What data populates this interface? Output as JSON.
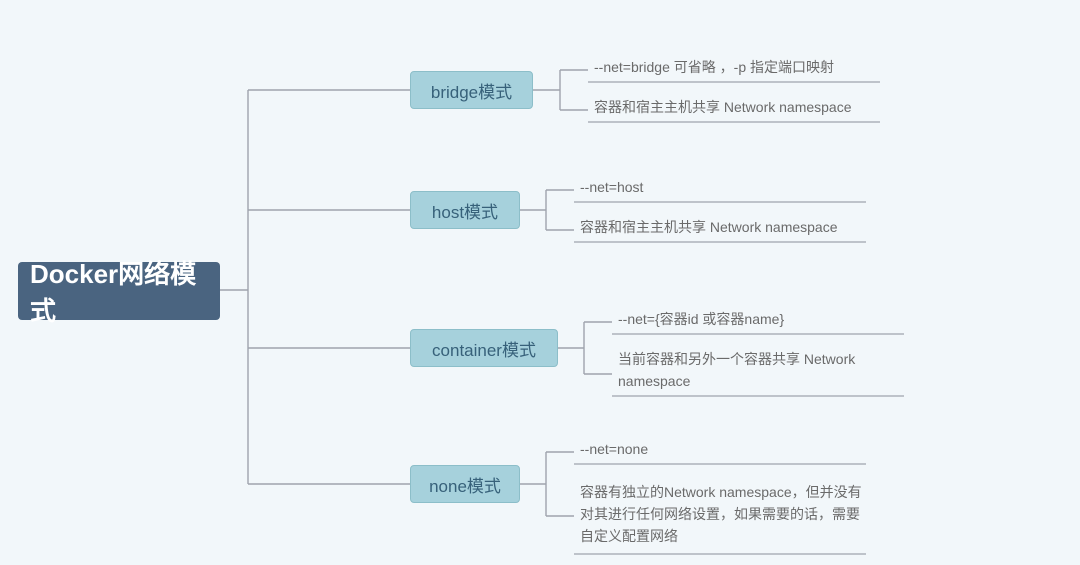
{
  "colors": {
    "background": "#f2f7fa",
    "root_bg": "#4a6480",
    "root_text": "#ffffff",
    "branch_bg": "#a6d1dc",
    "branch_border": "#8cbec9",
    "branch_text": "#37617a",
    "leaf_text": "#6a6a6a",
    "connector": "#9FA4AD"
  },
  "root": {
    "label": "Docker网络模式"
  },
  "branches": [
    {
      "key": "bridge",
      "label": "bridge模式",
      "leaves": [
        "--net=bridge   可省略 ，-p 指定端口映射",
        "容器和宿主主机共享 Network namespace"
      ]
    },
    {
      "key": "host",
      "label": "host模式",
      "leaves": [
        "--net=host",
        "容器和宿主主机共享 Network namespace"
      ]
    },
    {
      "key": "container",
      "label": "container模式",
      "leaves": [
        "--net={容器id 或容器name}",
        "当前容器和另外一个容器共享 Network namespace"
      ]
    },
    {
      "key": "none",
      "label": "none模式",
      "leaves": [
        "--net=none",
        "容器有独立的Network namespace，但并没有对其进行任何网络设置，如果需要的话，需要自定义配置网络"
      ]
    }
  ]
}
